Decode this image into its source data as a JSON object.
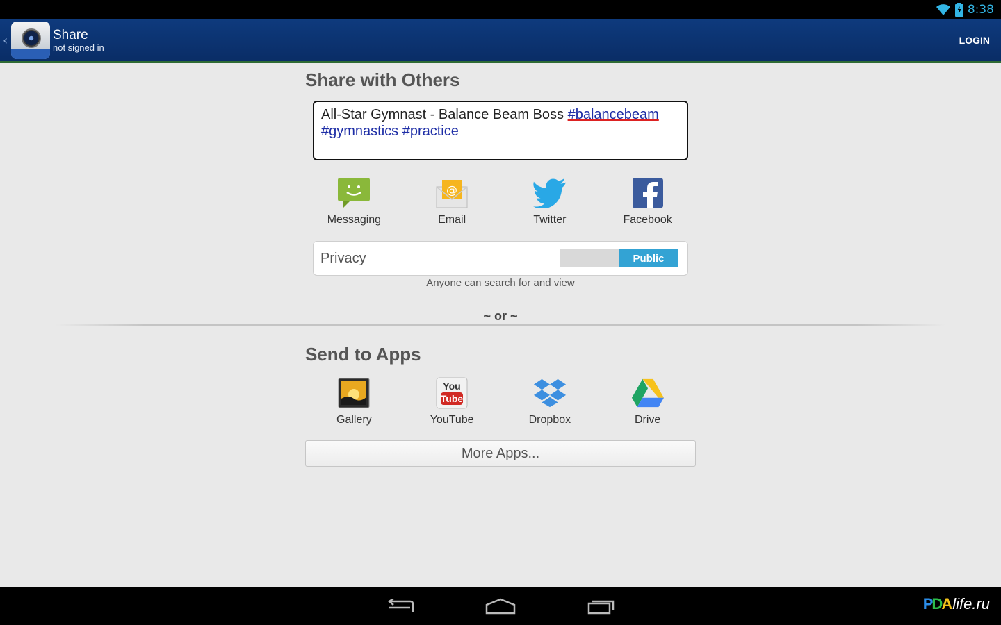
{
  "status_bar": {
    "time": "8:38"
  },
  "action_bar": {
    "title": "Share",
    "subtitle": "not signed in",
    "login_label": "LOGIN"
  },
  "share_section": {
    "title": "Share with Others",
    "message": {
      "text": "All-Star Gymnast - Balance Beam Boss ",
      "tags": [
        "#balancebeam",
        "#gymnastics",
        "#practice"
      ]
    },
    "targets": [
      {
        "label": "Messaging",
        "icon": "messaging-icon"
      },
      {
        "label": "Email",
        "icon": "email-icon"
      },
      {
        "label": "Twitter",
        "icon": "twitter-icon"
      },
      {
        "label": "Facebook",
        "icon": "facebook-icon"
      }
    ]
  },
  "privacy": {
    "label": "Privacy",
    "value": "Public",
    "description": "Anyone can search for and view"
  },
  "or_separator": "~ or ~",
  "apps_section": {
    "title": "Send to Apps",
    "apps": [
      {
        "label": "Gallery",
        "icon": "gallery-icon"
      },
      {
        "label": "YouTube",
        "icon": "youtube-icon"
      },
      {
        "label": "Dropbox",
        "icon": "dropbox-icon"
      },
      {
        "label": "Drive",
        "icon": "drive-icon"
      }
    ],
    "more_label": "More Apps..."
  },
  "watermark": {
    "text": "life.ru",
    "logo": "PDA"
  },
  "colors": {
    "action_bar": "#0e3a7d",
    "tag": "#1e2ea6",
    "toggle_on": "#33a3d4",
    "status_accent": "#33b5e5"
  }
}
